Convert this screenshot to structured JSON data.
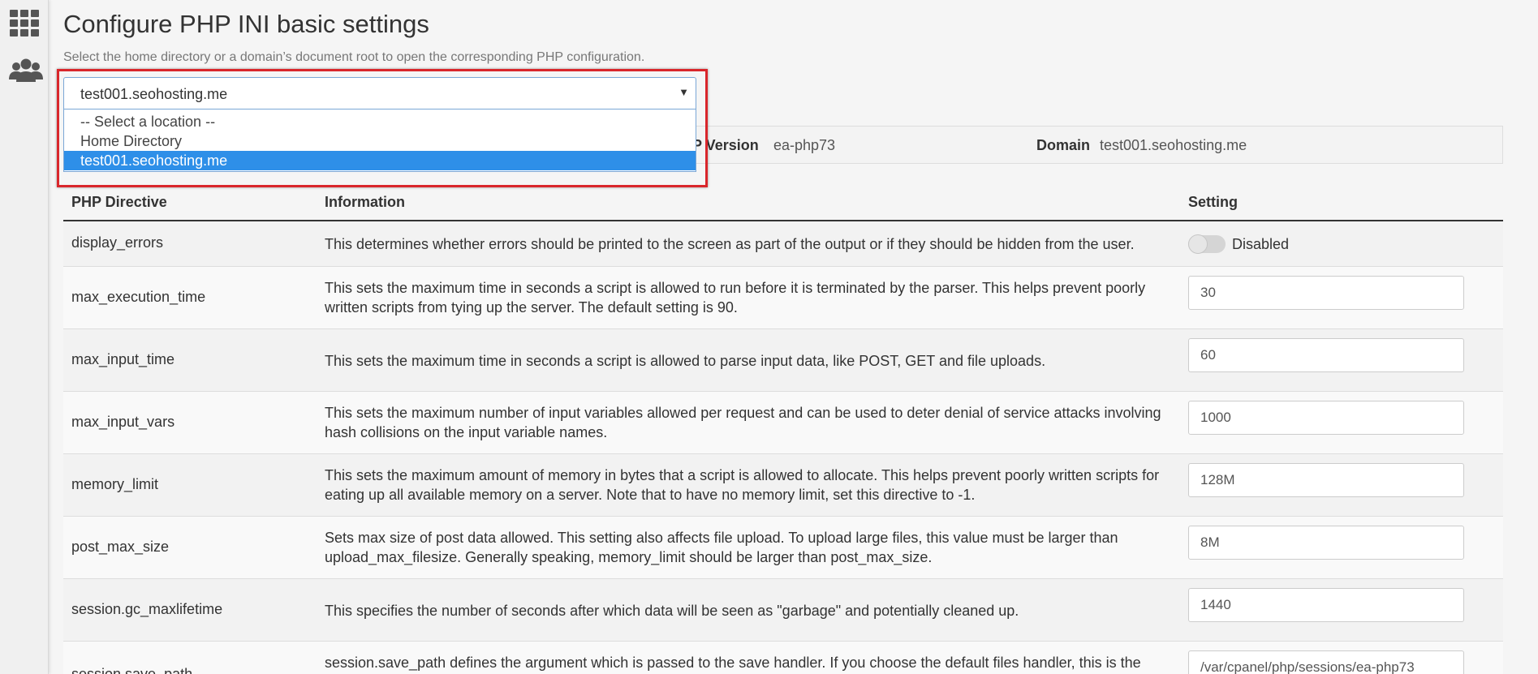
{
  "page": {
    "title": "Configure PHP INI basic settings",
    "description": "Select the home directory or a domain’s document root to open the corresponding PHP configuration."
  },
  "location_select": {
    "selected": "test001.seohosting.me",
    "options": [
      "-- Select a location --",
      "Home Directory",
      "test001.seohosting.me"
    ]
  },
  "info_bar": {
    "php_version_label": "P Version",
    "php_version_value": "ea-php73",
    "domain_label": "Domain",
    "domain_value": "test001.seohosting.me"
  },
  "table": {
    "headers": [
      "PHP Directive",
      "Information",
      "Setting"
    ],
    "rows": [
      {
        "directive": "display_errors",
        "info": "This determines whether errors should be printed to the screen as part of the output or if they should be hidden from the user.",
        "type": "toggle",
        "value": "Disabled"
      },
      {
        "directive": "max_execution_time",
        "info": "This sets the maximum time in seconds a script is allowed to run before it is terminated by the parser. This helps prevent poorly written scripts from tying up the server. The default setting is 90.",
        "type": "input",
        "value": "30"
      },
      {
        "directive": "max_input_time",
        "info": "This sets the maximum time in seconds a script is allowed to parse input data, like POST, GET and file uploads.",
        "type": "input",
        "value": "60"
      },
      {
        "directive": "max_input_vars",
        "info": "This sets the maximum number of input variables allowed per request and can be used to deter denial of service attacks involving hash collisions on the input variable names.",
        "type": "input",
        "value": "1000"
      },
      {
        "directive": "memory_limit",
        "info": "This sets the maximum amount of memory in bytes that a script is allowed to allocate. This helps prevent poorly written scripts for eating up all available memory on a server. Note that to have no memory limit, set this directive to -1.",
        "type": "input",
        "value": "128M"
      },
      {
        "directive": "post_max_size",
        "info": "Sets max size of post data allowed. This setting also affects file upload. To upload large files, this value must be larger than upload_max_filesize. Generally speaking, memory_limit should be larger than post_max_size.",
        "type": "input",
        "value": "8M"
      },
      {
        "directive": "session.gc_maxlifetime",
        "info": "This specifies the number of seconds after which data will be seen as \"garbage\" and potentially cleaned up.",
        "type": "input",
        "value": "1440"
      },
      {
        "directive": "session.save_path",
        "info": "session.save_path defines the argument which is passed to the save handler. If you choose the default files handler, this is the",
        "type": "input",
        "value": "/var/cpanel/php/sessions/ea-php73"
      }
    ]
  },
  "icons": {
    "apps": "grid-icon",
    "users": "users-icon"
  },
  "colors": {
    "highlight": "#d9262b",
    "selected_option": "#2e8fe8"
  }
}
